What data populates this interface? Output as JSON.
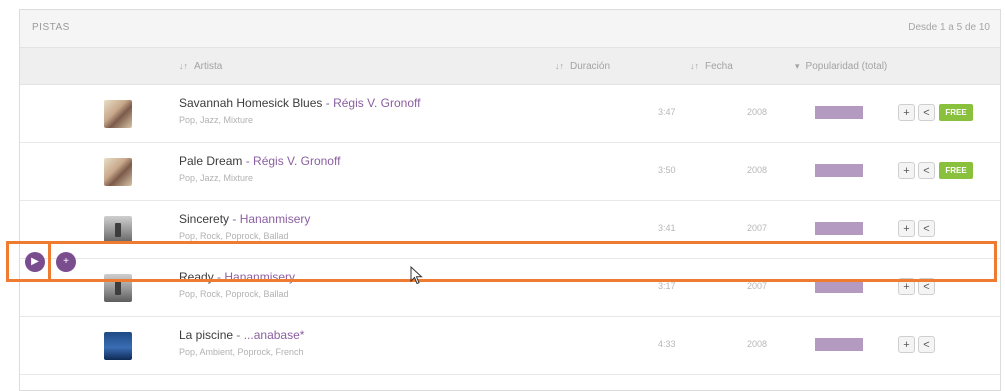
{
  "panel": {
    "title": "PISTAS",
    "range": "Desde 1 a 5 de 10"
  },
  "columns": {
    "artist": "Artista",
    "duration": "Duración",
    "date": "Fecha",
    "popularity": "Popularidad (total)",
    "sort_icon": "sort-icon"
  },
  "tracks": [
    {
      "title": "Savannah Homesick Blues",
      "artist": "Régis V. Gronoff",
      "separator": " - ",
      "genres": "Pop, Jazz, Mixture",
      "duration": "3:47",
      "year": "2008",
      "popularity": 1.0,
      "free_label": "FREE",
      "add_label": "+",
      "share_label": "<"
    },
    {
      "title": "Pale Dream",
      "artist": "Régis V. Gronoff",
      "separator": " - ",
      "genres": "Pop, Jazz, Mixture",
      "duration": "3:50",
      "year": "2008",
      "popularity": 1.0,
      "free_label": "FREE",
      "add_label": "+",
      "share_label": "<"
    },
    {
      "title": "Sincerety",
      "artist": "Hananmisery",
      "separator": " - ",
      "genres": "Pop, Rock, Poprock, Ballad",
      "duration": "3:41",
      "year": "2007",
      "popularity": 1.0,
      "add_label": "+",
      "share_label": "<"
    },
    {
      "title": "Ready",
      "artist": "Hananmisery",
      "separator": " - ",
      "genres": "Pop, Rock, Poprock, Ballad",
      "duration": "3:17",
      "year": "2007",
      "popularity": 1.0,
      "add_label": "+",
      "share_label": "<"
    },
    {
      "title": "La piscine",
      "artist": "...anabase*",
      "separator": " - ",
      "genres": "Pop, Ambient, Poprock, French",
      "duration": "4:33",
      "year": "2008",
      "popularity": 1.0,
      "add_label": "+",
      "share_label": "<"
    }
  ],
  "row_actions": {
    "play_icon": "play-icon",
    "queue_icon": "add-circle-icon"
  },
  "colors": {
    "accent": "#8b5fa0",
    "popularity_bar": "#b49ac1",
    "free_badge": "#89c13d",
    "highlight": "#ef7b30"
  }
}
